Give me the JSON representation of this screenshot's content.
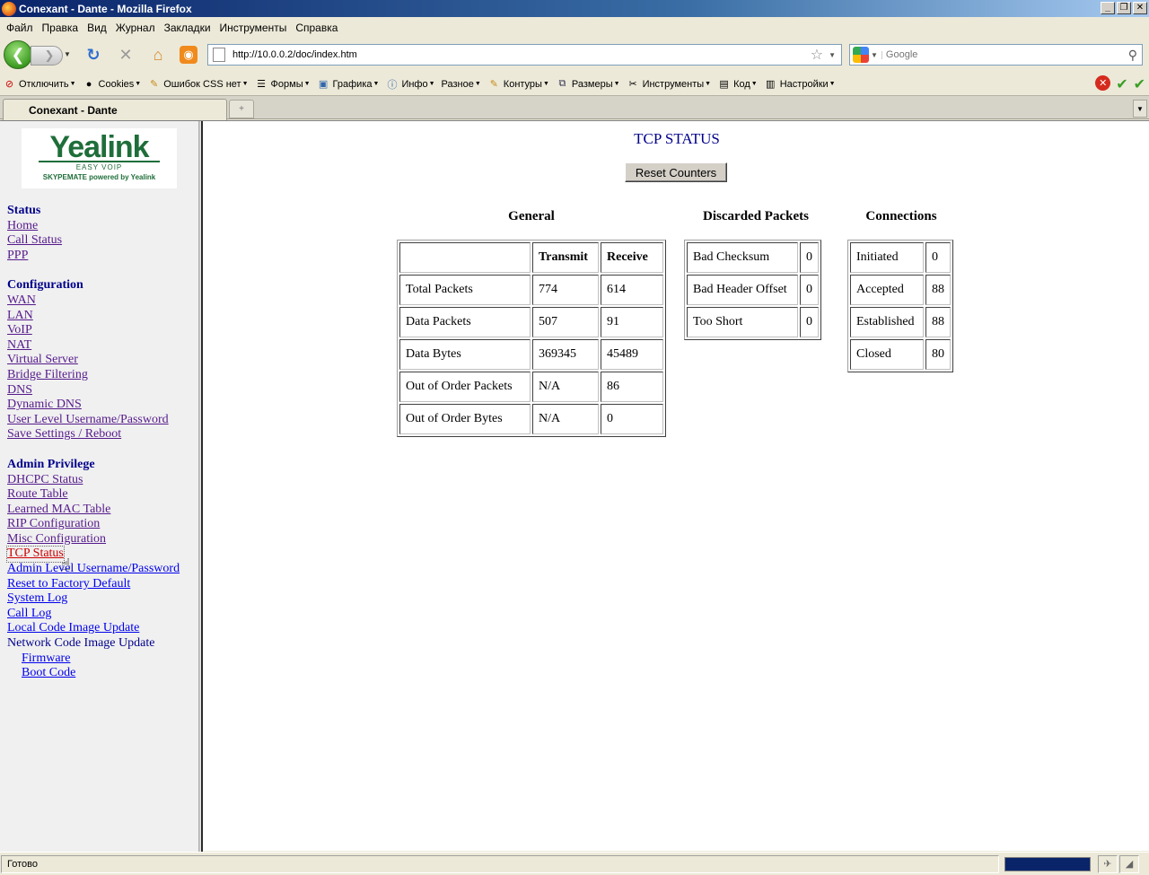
{
  "window": {
    "title": "Conexant - Dante - Mozilla Firefox"
  },
  "menubar": [
    "Файл",
    "Правка",
    "Вид",
    "Журнал",
    "Закладки",
    "Инструменты",
    "Справка"
  ],
  "nav": {
    "url": "http://10.0.0.2/doc/index.htm",
    "search_placeholder": "Google"
  },
  "devbar": [
    "Отключить",
    "Cookies",
    "Ошибок CSS нет",
    "Формы",
    "Графика",
    "Инфо",
    "Разное",
    "Контуры",
    "Размеры",
    "Инструменты",
    "Код",
    "Настройки"
  ],
  "tab": {
    "title": "Conexant - Dante"
  },
  "sidebar": {
    "logo": {
      "brand": "Yealink",
      "tagline": "EASY VOIP",
      "subline": "SKYPEMATE powered by Yealink"
    },
    "status_head": "Status",
    "status_links": [
      "Home",
      "Call Status",
      "PPP"
    ],
    "config_head": "Configuration",
    "config_links": [
      "WAN",
      "LAN",
      "VoIP",
      "NAT",
      "Virtual Server",
      "Bridge Filtering",
      "DNS",
      "Dynamic DNS",
      "User Level Username/Password",
      "Save Settings / Reboot"
    ],
    "admin_head": "Admin Privilege",
    "admin_links": [
      "DHCPC Status",
      "Route Table",
      "Learned MAC Table",
      "RIP Configuration",
      "Misc Configuration",
      "TCP Status",
      "Admin Level Username/Password",
      "Reset to Factory Default",
      "System Log",
      "Call Log",
      "Local Code Image Update"
    ],
    "network_update": "Network Code Image Update",
    "network_sub": [
      "Firmware",
      "Boot Code"
    ]
  },
  "main": {
    "title": "TCP STATUS",
    "reset_button": "Reset Counters",
    "general": {
      "heading": "General",
      "columns": [
        "",
        "Transmit",
        "Receive"
      ],
      "rows": [
        [
          "Total Packets",
          "774",
          "614"
        ],
        [
          "Data Packets",
          "507",
          "91"
        ],
        [
          "Data Bytes",
          "369345",
          "45489"
        ],
        [
          "Out of Order Packets",
          "N/A",
          "86"
        ],
        [
          "Out of Order Bytes",
          "N/A",
          "0"
        ]
      ]
    },
    "discarded": {
      "heading": "Discarded Packets",
      "rows": [
        [
          "Bad Checksum",
          "0"
        ],
        [
          "Bad Header Offset",
          "0"
        ],
        [
          "Too Short",
          "0"
        ]
      ]
    },
    "connections": {
      "heading": "Connections",
      "rows": [
        [
          "Initiated",
          "0"
        ],
        [
          "Accepted",
          "88"
        ],
        [
          "Established",
          "88"
        ],
        [
          "Closed",
          "80"
        ]
      ]
    }
  },
  "statusbar": {
    "text": "Готово"
  }
}
